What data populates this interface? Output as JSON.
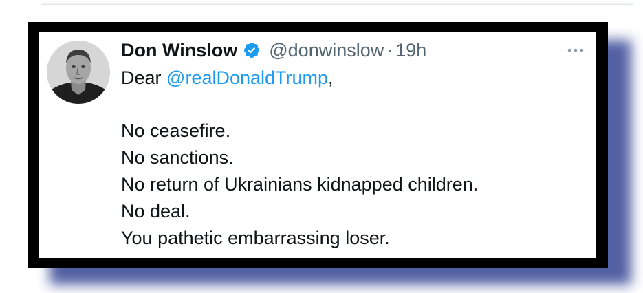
{
  "tweet": {
    "author": {
      "name": "Don Winslow",
      "handle": "@donwinslow",
      "verified": true
    },
    "separator": "·",
    "time": "19h",
    "greeting": {
      "prefix": "Dear ",
      "mention": "@realDonaldTrump",
      "suffix": ","
    },
    "lines": [
      "No ceasefire.",
      "No sanctions.",
      "No return of Ukrainians kidnapped children.",
      "No deal.",
      "You pathetic embarrassing loser."
    ]
  },
  "icons": {
    "verified": "verified-badge-icon",
    "more": "more-options-icon"
  },
  "colors": {
    "text": "#0f1419",
    "secondary": "#536471",
    "link": "#1d9bf0",
    "frame": "#000000",
    "shadow": "#3f4f9a"
  }
}
